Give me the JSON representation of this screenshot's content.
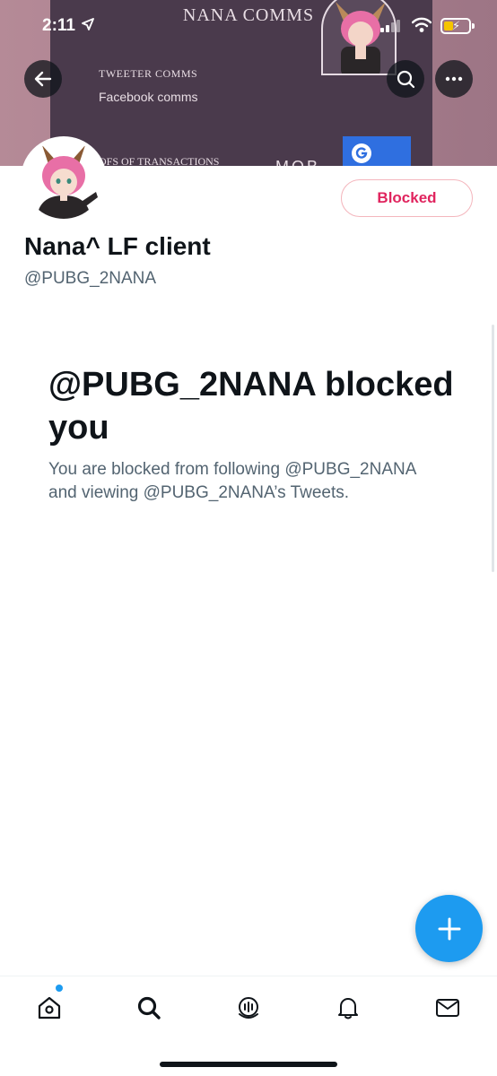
{
  "status_bar": {
    "time": "2:11",
    "icons": [
      "location-arrow-icon",
      "cellular-signal-icon",
      "wifi-icon",
      "battery-charging-icon"
    ],
    "battery_color": "#f5c400"
  },
  "banner": {
    "title": "NANA COMMS",
    "line1": "TWEETER COMMS",
    "line2": "Facebook comms",
    "line3": "OFS OF TRANSACTIONS",
    "line4": "MOB"
  },
  "header": {
    "buttons": [
      "back-arrow-icon",
      "search-icon",
      "more-icon"
    ]
  },
  "profile": {
    "display_name": "Nana^ LF client",
    "handle": "@PUBG_2NANA",
    "blocked_label": "Blocked"
  },
  "blocked_message": {
    "title": "@PUBG_2NANA blocked you",
    "description": "You are blocked from following @PUBG_2NANA and viewing @PUBG_2NANA’s Tweets."
  },
  "bottom_nav": {
    "items": [
      "home-icon",
      "search-icon",
      "spaces-icon",
      "notifications-icon",
      "messages-icon"
    ]
  },
  "colors": {
    "accent": "#1d9bf0",
    "blocked_red": "#e0245e",
    "text_primary": "#0f1419",
    "text_secondary": "#536471"
  }
}
